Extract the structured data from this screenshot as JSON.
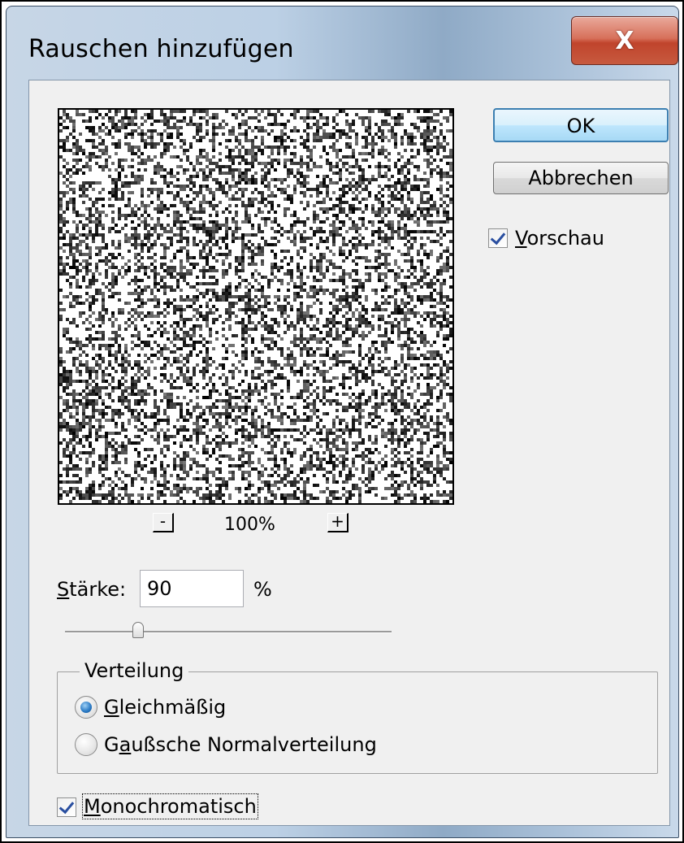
{
  "window": {
    "title": "Rauschen hinzufügen",
    "close_label": "X"
  },
  "buttons": {
    "ok_label": "OK",
    "cancel_label": "Abbrechen"
  },
  "preview_checkbox": {
    "label_key": "V",
    "label_rest": "orschau",
    "checked": true
  },
  "zoom": {
    "minus_label": "-",
    "plus_label": "+",
    "level": "100%"
  },
  "strength": {
    "label_key": "S",
    "label_rest": "tärke:",
    "value": "90",
    "unit": "%",
    "slider_fraction": 0.225
  },
  "distribution": {
    "title": "Verteilung",
    "options": [
      {
        "key": "G",
        "rest": "leichmäßig",
        "selected": true
      },
      {
        "pre": "G",
        "key": "a",
        "rest": "ußsche Normalverteilung",
        "selected": false
      }
    ]
  },
  "monochrome": {
    "label_key": "M",
    "label_rest": "onochromatisch",
    "checked": true
  },
  "colors": {
    "ok_border": "#3c7fb1",
    "checkmark": "#2a4fa0",
    "close_button": "#c0442c"
  }
}
